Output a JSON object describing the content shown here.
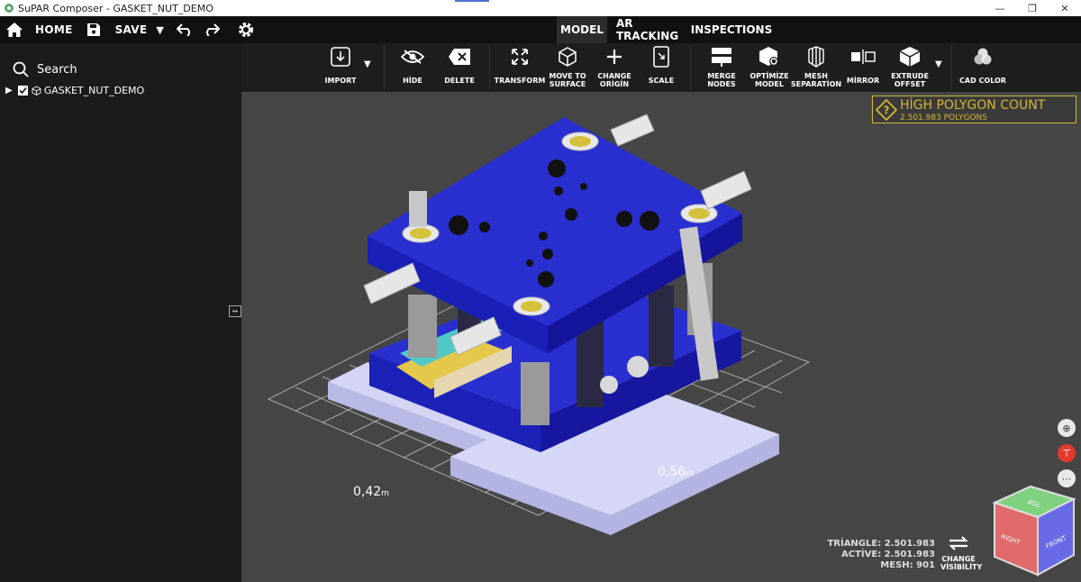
{
  "window": {
    "title": "SuPAR Composer - GASKET_NUT_DEMO"
  },
  "topbar": {
    "home": "HOME",
    "save": "SAVE"
  },
  "modes": [
    {
      "label": "MODEL",
      "active": true
    },
    {
      "label": "AR TRACKING",
      "active": false
    },
    {
      "label": "INSPECTIONS",
      "active": false
    }
  ],
  "sidebar": {
    "search_label": "Search",
    "tree": [
      {
        "label": "GASKET_NUT_DEMO",
        "checked": true
      }
    ]
  },
  "toolbar": {
    "import": "IMPORT",
    "hide": "HİDE",
    "delete": "DELETE",
    "transform": "TRANSFORM",
    "move_l1": "MOVE TO",
    "move_l2": "SURFACE",
    "origin_l1": "CHANGE",
    "origin_l2": "ORİGİN",
    "scale": "SCALE",
    "merge_l1": "MERGE",
    "merge_l2": "NODES",
    "optimize_l1": "OPTİMİZE",
    "optimize_l2": "MODEL",
    "mesh_l1": "MESH",
    "mesh_l2": "SEPARATİON",
    "mirror": "MİRROR",
    "extrude_l1": "EXTRUDE",
    "extrude_l2": "OFFSET",
    "cadcolor": "CAD COLOR"
  },
  "warning": {
    "title": "HİGH POLYGON COUNT",
    "subtitle": "2.501.983 POLYGONS"
  },
  "dimensions": {
    "depth": "0,42",
    "width": "0,56",
    "unit": "m"
  },
  "stats": {
    "triangle": "TRİANGLE: 2.501.983",
    "active": "ACTİVE: 2.501.983",
    "mesh": "MESH: 901"
  },
  "visibility": {
    "l1": "CHANGE",
    "l2": "VİSİBİLİTY"
  },
  "viewcube": {
    "top": "TOP",
    "right": "RIGHT",
    "front": "FRONT"
  },
  "colors": {
    "accent_warning": "#d4b734",
    "plate": "#2a2fd0",
    "viewport": "#464646"
  }
}
